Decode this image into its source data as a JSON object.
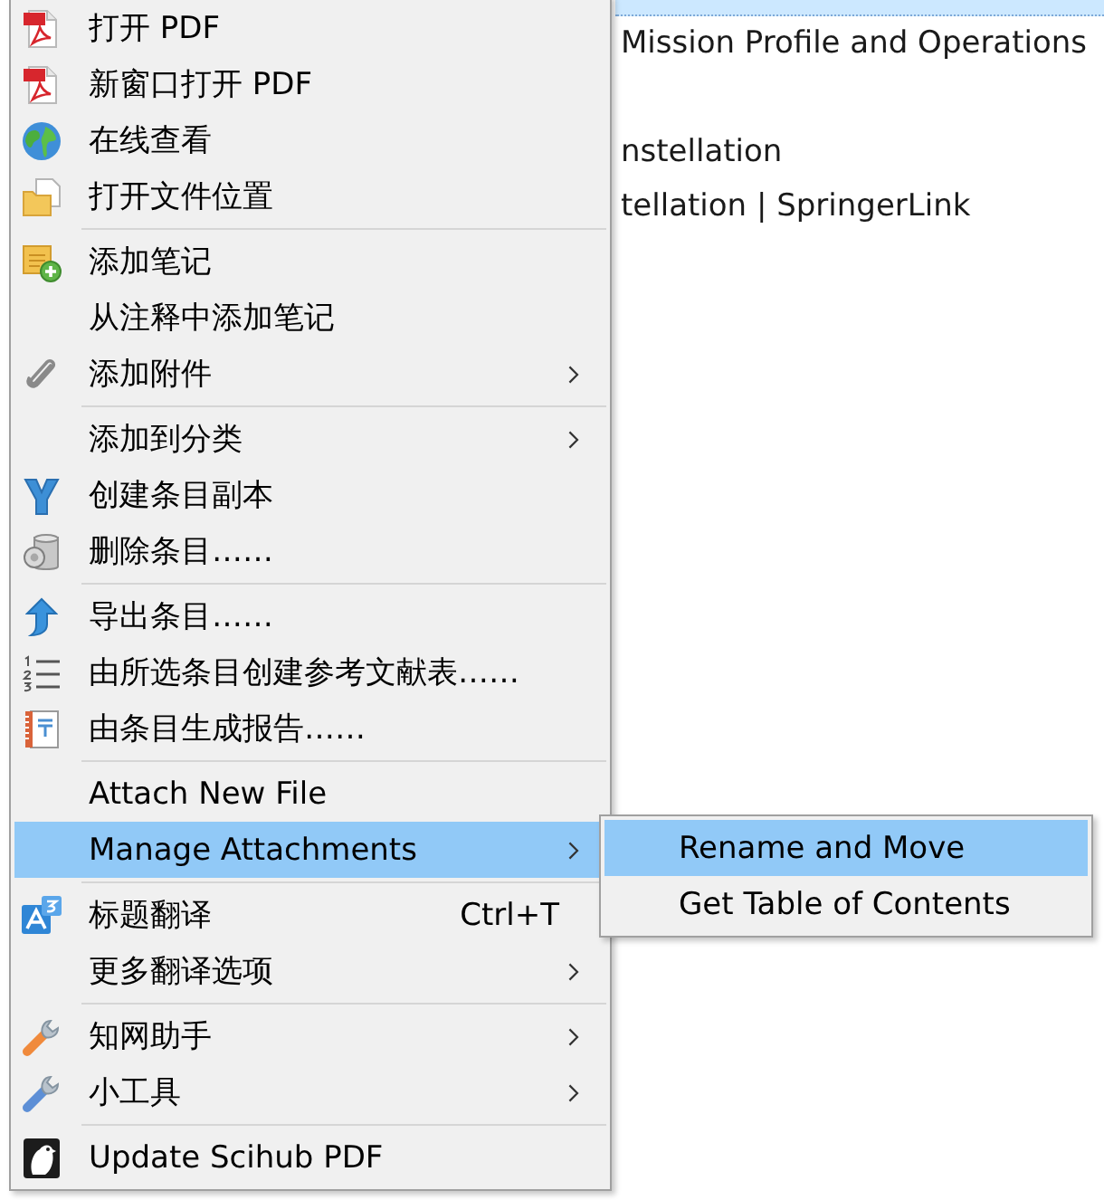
{
  "background_list": {
    "rows": [
      {
        "selected": true
      },
      {
        "text": "Mission Profile and Operations",
        "selected": false
      },
      {
        "selected": false
      },
      {
        "text": "nstellation",
        "selected": false
      },
      {
        "text": "tellation | SpringerLink",
        "selected": false
      }
    ]
  },
  "context_menu": {
    "sections": [
      {
        "items": [
          {
            "label": "打开 PDF",
            "selected": false,
            "has_submenu": false
          },
          {
            "label": "新窗口打开 PDF",
            "selected": false,
            "has_submenu": false
          },
          {
            "label": "在线查看",
            "selected": false,
            "has_submenu": false
          },
          {
            "label": "打开文件位置",
            "selected": false,
            "has_submenu": false
          }
        ]
      },
      {
        "items": [
          {
            "label": "添加笔记",
            "selected": false,
            "has_submenu": false
          },
          {
            "label": "从注释中添加笔记",
            "selected": false,
            "has_submenu": false
          },
          {
            "label": "添加附件",
            "selected": false,
            "has_submenu": true
          }
        ]
      },
      {
        "items": [
          {
            "label": "添加到分类",
            "selected": false,
            "has_submenu": true
          },
          {
            "label": "创建条目副本",
            "selected": false,
            "has_submenu": false
          },
          {
            "label": "删除条目……",
            "selected": false,
            "has_submenu": false
          }
        ]
      },
      {
        "items": [
          {
            "label": "导出条目……",
            "selected": false,
            "has_submenu": false
          },
          {
            "label": "由所选条目创建参考文献表……",
            "selected": false,
            "has_submenu": false
          },
          {
            "label": "由条目生成报告……",
            "selected": false,
            "has_submenu": false
          }
        ]
      },
      {
        "items": [
          {
            "label": "Attach New File",
            "selected": false,
            "has_submenu": false
          },
          {
            "label": "Manage Attachments",
            "selected": true,
            "has_submenu": true
          }
        ]
      },
      {
        "items": [
          {
            "label": "标题翻译",
            "shortcut": "Ctrl+T",
            "selected": false,
            "has_submenu": false
          },
          {
            "label": "更多翻译选项",
            "selected": false,
            "has_submenu": true
          }
        ]
      },
      {
        "items": [
          {
            "label": "知网助手",
            "selected": false,
            "has_submenu": true
          },
          {
            "label": "小工具",
            "selected": false,
            "has_submenu": true
          }
        ]
      },
      {
        "items": [
          {
            "label": "Update Scihub PDF",
            "selected": false,
            "has_submenu": false
          }
        ]
      }
    ]
  },
  "submenu": {
    "items": [
      {
        "label": "Rename and Move",
        "selected": true
      },
      {
        "label": "Get Table of Contents",
        "selected": false
      }
    ]
  }
}
